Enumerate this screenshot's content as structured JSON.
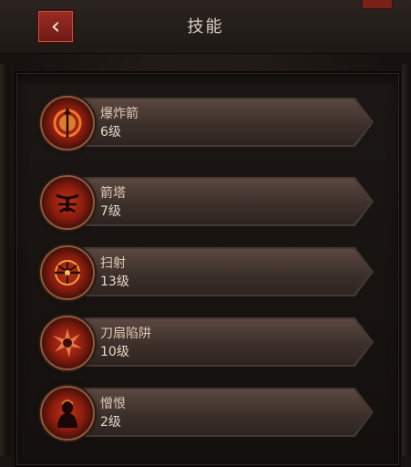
{
  "header": {
    "title": "技能",
    "back_icon": "‹"
  },
  "skills": [
    {
      "name": "爆炸箭",
      "level": "6级",
      "icon": "explosive-arrow-icon"
    },
    {
      "name": "箭塔",
      "level": "7级",
      "icon": "arrow-tower-icon"
    },
    {
      "name": "扫射",
      "level": "13级",
      "icon": "strafe-icon"
    },
    {
      "name": "刀扇陷阱",
      "level": "10级",
      "icon": "blade-fan-trap-icon"
    },
    {
      "name": "憎恨",
      "level": "2级",
      "icon": "hatred-icon"
    }
  ]
}
